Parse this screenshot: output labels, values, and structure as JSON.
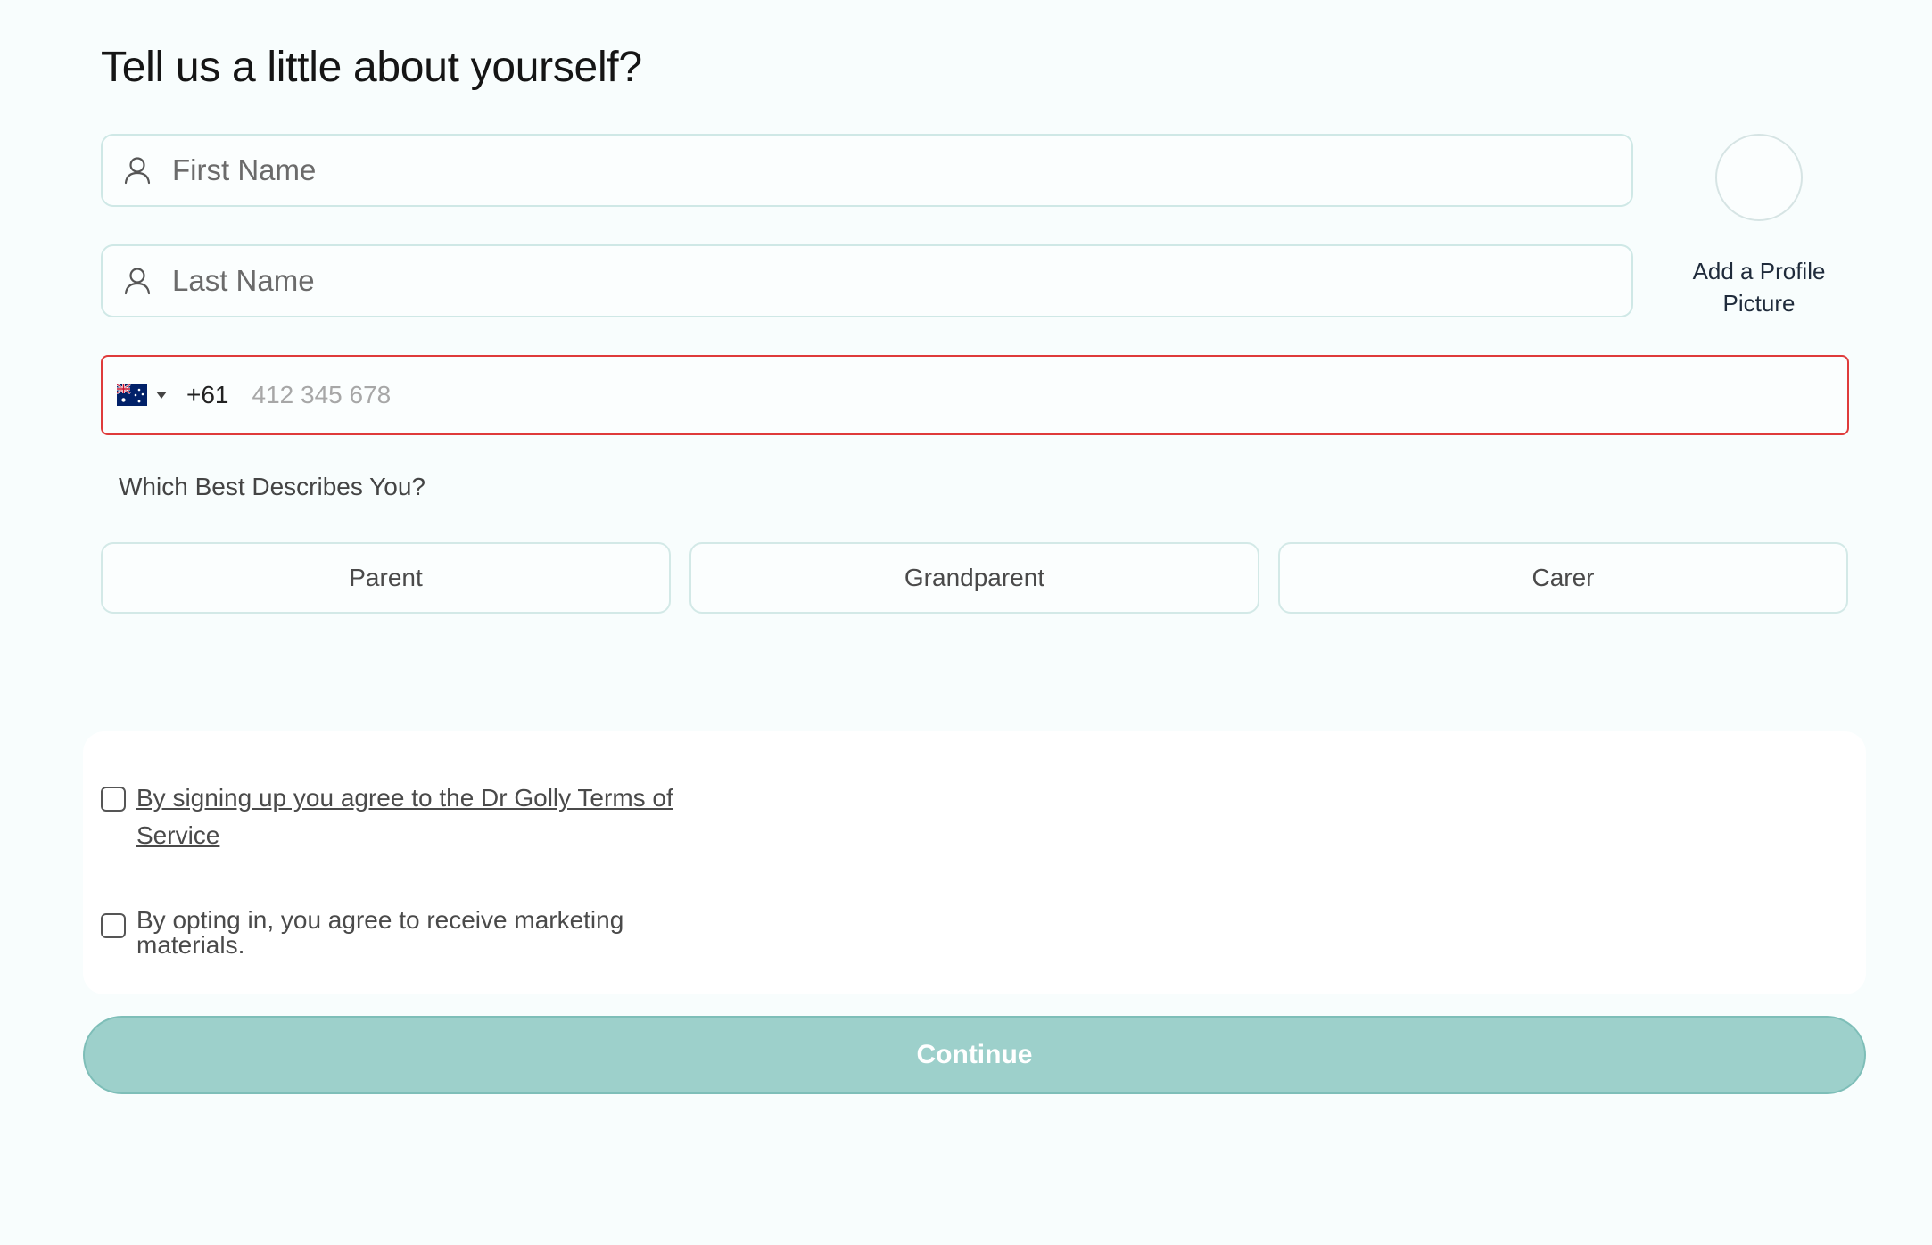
{
  "page": {
    "title": "Tell us a little about yourself?"
  },
  "form": {
    "first_name": {
      "placeholder": "First Name",
      "value": "",
      "icon": "user-icon"
    },
    "last_name": {
      "placeholder": "Last Name",
      "value": "",
      "icon": "user-icon"
    },
    "profile_picture": {
      "label": "Add a Profile Picture"
    },
    "phone": {
      "country_flag": "australia-flag-icon",
      "dial_code": "+61",
      "placeholder": "412 345 678",
      "value": "",
      "error_color": "#df3b3b"
    },
    "describe": {
      "question": "Which Best Describes You?",
      "options": [
        "Parent",
        "Grandparent",
        "Carer"
      ]
    },
    "consents": {
      "terms": {
        "label": "By signing up you agree to the Dr Golly Terms of Service",
        "checked": false
      },
      "marketing": {
        "label": "By opting in, you agree to receive marketing materials.",
        "checked": false
      }
    },
    "continue_label": "Continue"
  },
  "colors": {
    "accent": "#9dd0cb",
    "field_border": "#cfe8e6",
    "background": "#f8fdfd"
  }
}
